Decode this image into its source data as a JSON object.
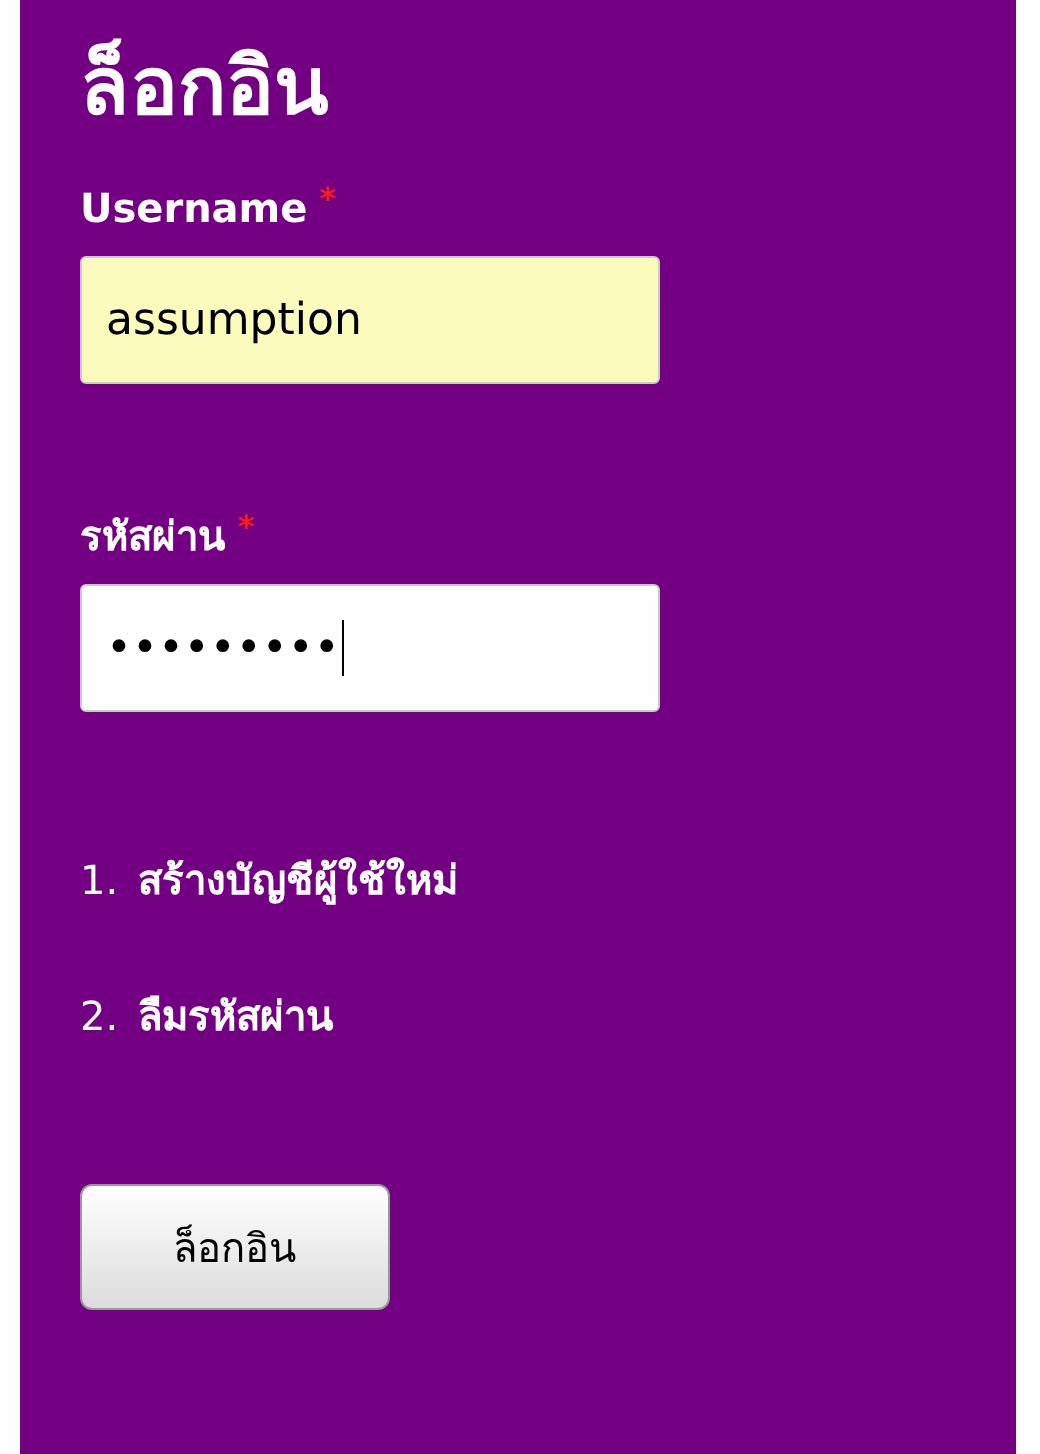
{
  "title": "ล็อกอิน",
  "fields": [
    {
      "label": "Username",
      "required": true,
      "value": "assumption",
      "highlighted": true,
      "focused": false
    },
    {
      "label": "รหัสผ่าน",
      "required": true,
      "value": "•••••••••",
      "highlighted": false,
      "focused": true
    }
  ],
  "required_mark": "*",
  "links": [
    {
      "number": "1.",
      "text": "สร้างบัญชีผู้ใช้ใหม่"
    },
    {
      "number": "2.",
      "text": "ลืมรหัสผ่าน"
    }
  ],
  "button": "ล็อกอิน"
}
